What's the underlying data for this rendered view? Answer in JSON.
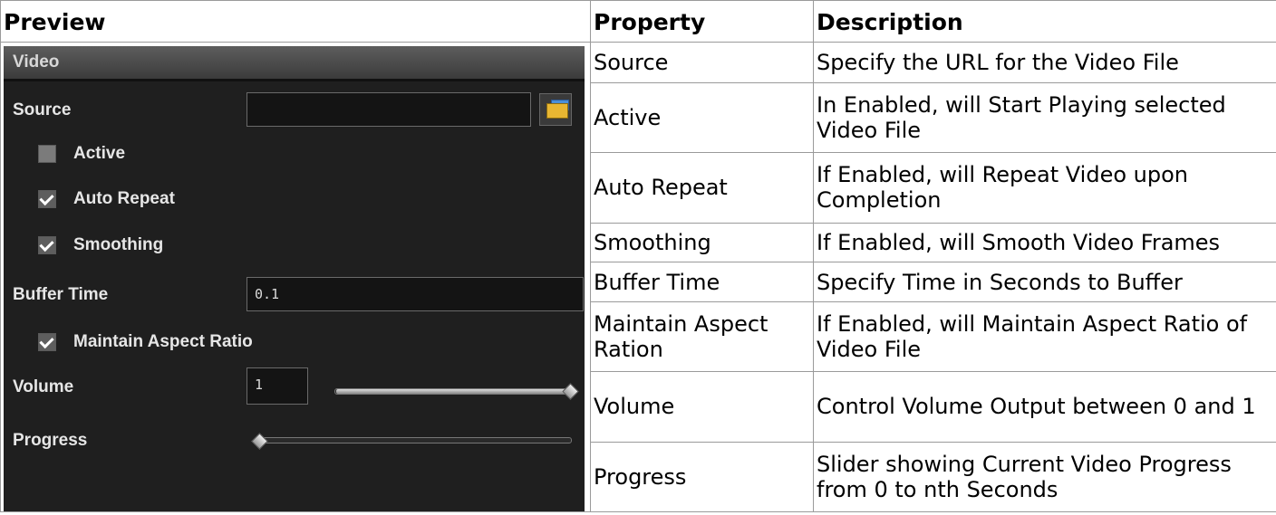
{
  "headers": {
    "preview": "Preview",
    "property": "Property",
    "description": "Description"
  },
  "preview": {
    "panel_title": "Video",
    "source_label": "Source",
    "source_value": "",
    "active_label": "Active",
    "active_checked": false,
    "auto_repeat_label": "Auto Repeat",
    "auto_repeat_checked": true,
    "smoothing_label": "Smoothing",
    "smoothing_checked": true,
    "buffer_time_label": "Buffer Time",
    "buffer_time_value": "0.1",
    "maintain_label": "Maintain Aspect Ratio",
    "maintain_checked": true,
    "volume_label": "Volume",
    "volume_value": "1",
    "volume_level": 1.0,
    "progress_label": "Progress",
    "progress_level": 0.0
  },
  "rows": [
    {
      "property": "Source",
      "description": "Specify the URL for the Video File"
    },
    {
      "property": "Active",
      "description": "In Enabled, will Start Playing selected Video File"
    },
    {
      "property": "Auto Repeat",
      "description": "If Enabled, will Repeat Video upon Completion"
    },
    {
      "property": "Smoothing",
      "description": "If Enabled, will Smooth Video Frames"
    },
    {
      "property": "Buffer Time",
      "description": "Specify Time in Seconds to Buffer"
    },
    {
      "property": "Maintain Aspect Ration",
      "description": "If Enabled, will Maintain Aspect Ratio of Video File"
    },
    {
      "property": "Volume",
      "description": "Control Volume Output between 0 and 1"
    },
    {
      "property": "Progress",
      "description": "Slider showing Current Video Progress from 0 to nth Seconds"
    }
  ]
}
